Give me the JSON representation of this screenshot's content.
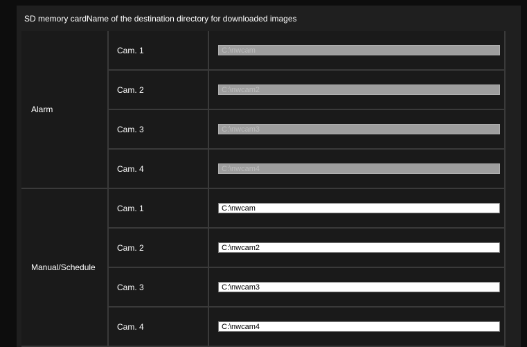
{
  "header": {
    "title": "SD memory cardName of the destination directory for downloaded images"
  },
  "alarm": {
    "label": "Alarm",
    "rows": [
      {
        "cam": "Cam. 1",
        "value": "C:\\nwcam"
      },
      {
        "cam": "Cam. 2",
        "value": "C:\\nwcam2"
      },
      {
        "cam": "Cam. 3",
        "value": "C:\\nwcam3"
      },
      {
        "cam": "Cam. 4",
        "value": "C:\\nwcam4"
      }
    ]
  },
  "manual": {
    "label": "Manual/Schedule",
    "rows": [
      {
        "cam": "Cam. 1",
        "value": "C:\\nwcam"
      },
      {
        "cam": "Cam. 2",
        "value": "C:\\nwcam2"
      },
      {
        "cam": "Cam. 3",
        "value": "C:\\nwcam3"
      },
      {
        "cam": "Cam. 4",
        "value": "C:\\nwcam4"
      }
    ]
  }
}
